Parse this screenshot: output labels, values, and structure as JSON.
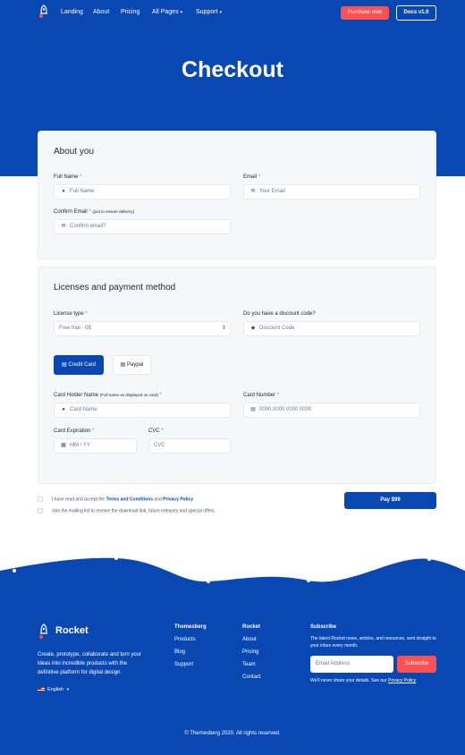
{
  "nav": {
    "links": [
      "Landing",
      "About",
      "Pricing",
      "All Pages",
      "Support"
    ],
    "purchase_label": "Purchase now",
    "docs_label": "Docs v1.0"
  },
  "page_title": "Checkout",
  "about": {
    "title": "About you",
    "full_name_label": "Full Name",
    "full_name_placeholder": "Full Name",
    "email_label": "Email",
    "email_placeholder": "Your Email",
    "confirm_email_label": "Confirm Email",
    "confirm_email_note": "(just to ensure delivery)",
    "confirm_email_placeholder": "Confirm email?"
  },
  "payment": {
    "title": "Licenses and payment method",
    "license_label": "License type",
    "license_value": "Free trial - 0$",
    "discount_label": "Do you have a discount code?",
    "discount_placeholder": "Discount Code",
    "tab_credit": "Credit Card",
    "tab_paypal": "Paypal",
    "holder_label": "Card Holder Name",
    "holder_note": "(Full name as displayed on card)",
    "holder_placeholder": "Card Name",
    "number_label": "Card Number",
    "number_placeholder": "0000 0000 0000 0000",
    "expiration_label": "Card Expiration",
    "expiration_placeholder": "MM / YY",
    "cvc_label": "CVC",
    "cvc_placeholder": "CVC",
    "required_mark": "*"
  },
  "terms": {
    "prefix": "I have read and accept the",
    "terms_link": "Terms and Conditions",
    "and": "and",
    "privacy_link": "Privacy Policy",
    "mailing": "Join the mailing list to receive the download link, future releases and special offers."
  },
  "pay_button": "Pay $99",
  "footer": {
    "brand": "Rocket",
    "description": "Create, prototype, collaborate and turn your ideas into incredible products with the definitive platform for digital design.",
    "language": "English",
    "col1_title": "Themesberg",
    "col1_links": [
      "Products",
      "Blog",
      "Support"
    ],
    "col2_title": "Rocket",
    "col2_links": [
      "About",
      "Pricing",
      "Team",
      "Contact"
    ],
    "subscribe_title": "Subscribe",
    "subscribe_text": "The latest Rocket news, articles, and resources, sent straight to your inbox every month.",
    "email_placeholder": "Email Address",
    "subscribe_button": "Subscribe",
    "privacy_prefix": "We'll never share your details. See our",
    "privacy_link": "Privacy Policy",
    "copyright": "© Themesberg 2020. All rights reserved."
  },
  "colors": {
    "primary": "#0948b3",
    "accent": "#fa5252",
    "card_bg": "#f5f8fb"
  },
  "icons": [
    "rocket-icon",
    "user-icon",
    "envelope-icon",
    "tag-icon",
    "credit-card-icon",
    "calendar-icon",
    "chevron-down-icon"
  ]
}
